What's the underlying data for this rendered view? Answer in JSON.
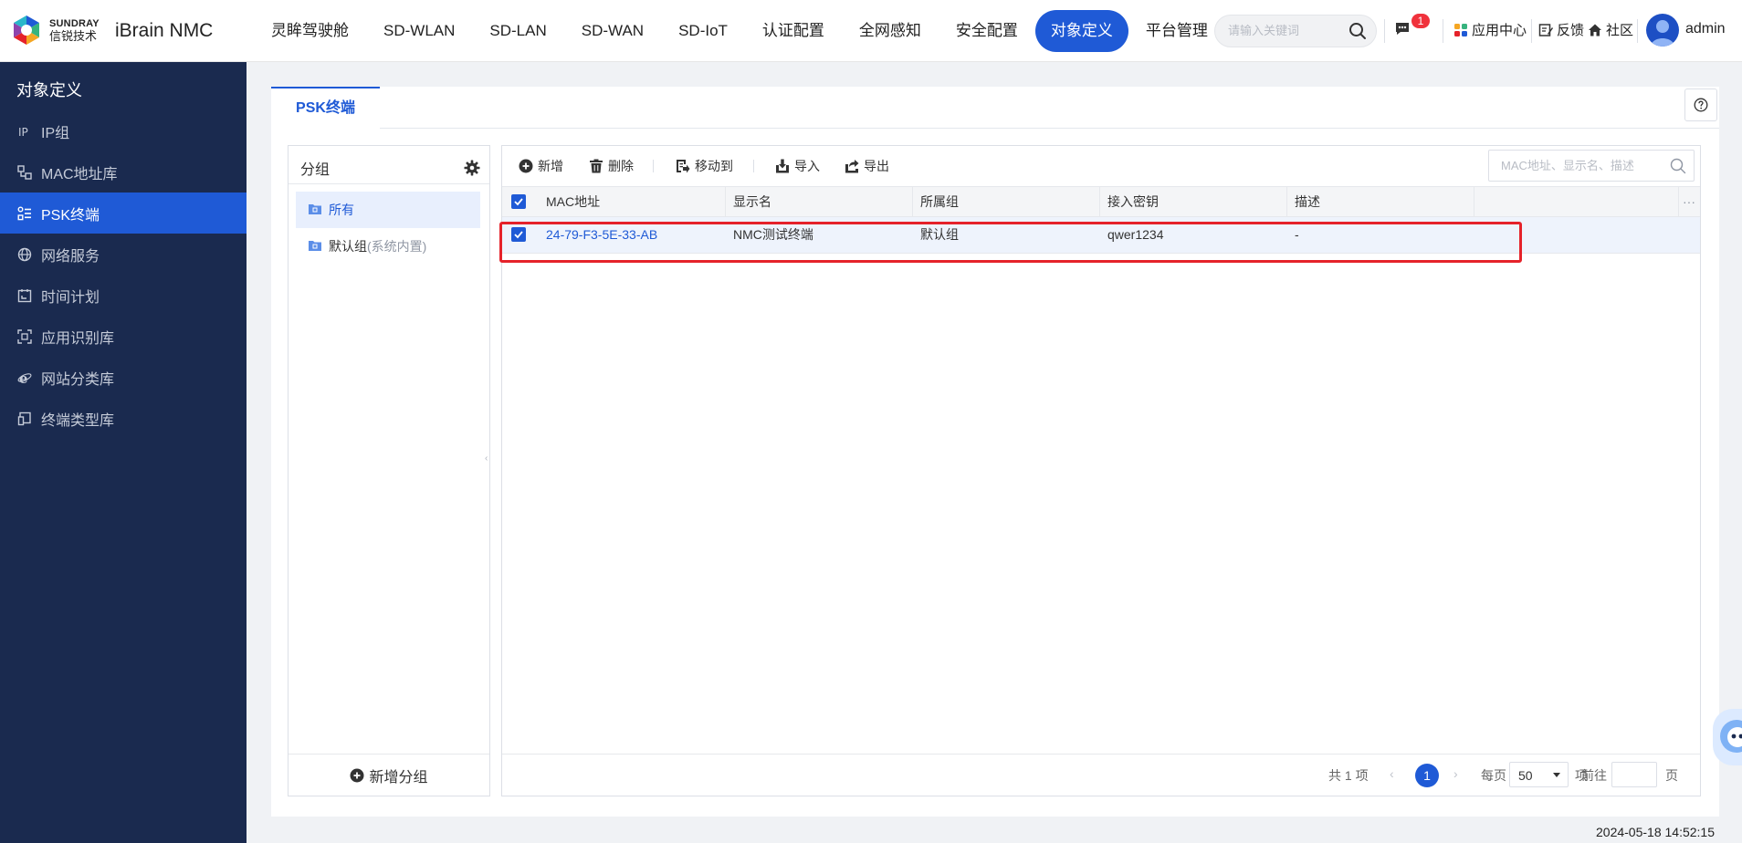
{
  "brand": {
    "logo_en": "SUNDRAY",
    "logo_cn": "信锐技术",
    "product": "iBrain NMC"
  },
  "nav": {
    "items": [
      "灵眸驾驶舱",
      "SD-WLAN",
      "SD-LAN",
      "SD-WAN",
      "SD-IoT",
      "认证配置",
      "全网感知",
      "安全配置",
      "对象定义",
      "平台管理"
    ],
    "active_index": 8
  },
  "header": {
    "search_placeholder": "请输入关键词",
    "message_badge": "1",
    "app_center": "应用中心",
    "feedback": "反馈",
    "community": "社区",
    "username": "admin"
  },
  "sidebar": {
    "title": "对象定义",
    "items": [
      {
        "label": "IP组",
        "icon": "ip-icon"
      },
      {
        "label": "MAC地址库",
        "icon": "mac-icon"
      },
      {
        "label": "PSK终端",
        "icon": "psk-icon"
      },
      {
        "label": "网络服务",
        "icon": "globe-icon"
      },
      {
        "label": "时间计划",
        "icon": "calendar-icon"
      },
      {
        "label": "应用识别库",
        "icon": "scan-icon"
      },
      {
        "label": "网站分类库",
        "icon": "ie-icon"
      },
      {
        "label": "终端类型库",
        "icon": "device-icon"
      }
    ],
    "active_index": 2
  },
  "main": {
    "tab": "PSK终端",
    "groups": {
      "title": "分组",
      "items": [
        {
          "label": "所有",
          "sub": ""
        },
        {
          "label": "默认组",
          "sub": "(系统内置)"
        }
      ],
      "add_label": "新增分组"
    },
    "toolbar": {
      "add": "新增",
      "delete": "删除",
      "move": "移动到",
      "import": "导入",
      "export": "导出",
      "search_placeholder": "MAC地址、显示名、描述"
    },
    "table": {
      "columns": [
        "MAC地址",
        "显示名",
        "所属组",
        "接入密钥",
        "描述"
      ],
      "more": "···",
      "rows": [
        {
          "mac": "24-79-F3-5E-33-AB",
          "name": "NMC测试终端",
          "group": "默认组",
          "key": "qwer1234",
          "desc": "-",
          "checked": true
        }
      ]
    },
    "pager": {
      "total": "共 1 项",
      "prev": "‹",
      "current": "1",
      "next": "›",
      "per_page_label": "每页",
      "page_size": "50",
      "item_unit": "项",
      "goto_label": "前往",
      "page_unit": "页"
    }
  },
  "footer": {
    "timestamp": "2024-05-18 14:52:15"
  },
  "colors": {
    "primary": "#1f5ad6",
    "sidebar_bg": "#1a2a4f",
    "highlight": "#e5222a",
    "badge": "#f0323c"
  }
}
